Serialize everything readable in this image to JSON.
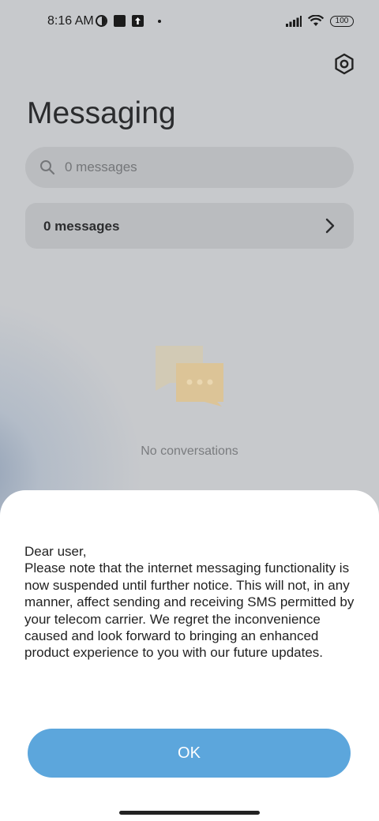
{
  "status_bar": {
    "time": "8:16 AM",
    "battery": "100"
  },
  "header": {
    "title": "Messaging",
    "settings_icon": "settings-icon"
  },
  "search": {
    "placeholder": "0 messages"
  },
  "messages_row": {
    "label": "0 messages"
  },
  "empty_state": {
    "text": "No conversations"
  },
  "dialog": {
    "message": "Dear user,\nPlease note that the internet messaging functionality is now suspended until further notice. This will not, in any manner, affect sending and receiving SMS permitted by your telecom carrier. We regret the inconvenience caused and look forward to bringing an enhanced product experience to you with our future updates.",
    "ok_label": "OK"
  },
  "colors": {
    "accent": "#5ca6dc",
    "dim_background": "#c7c9cc",
    "illustration": "#f3d39a"
  }
}
